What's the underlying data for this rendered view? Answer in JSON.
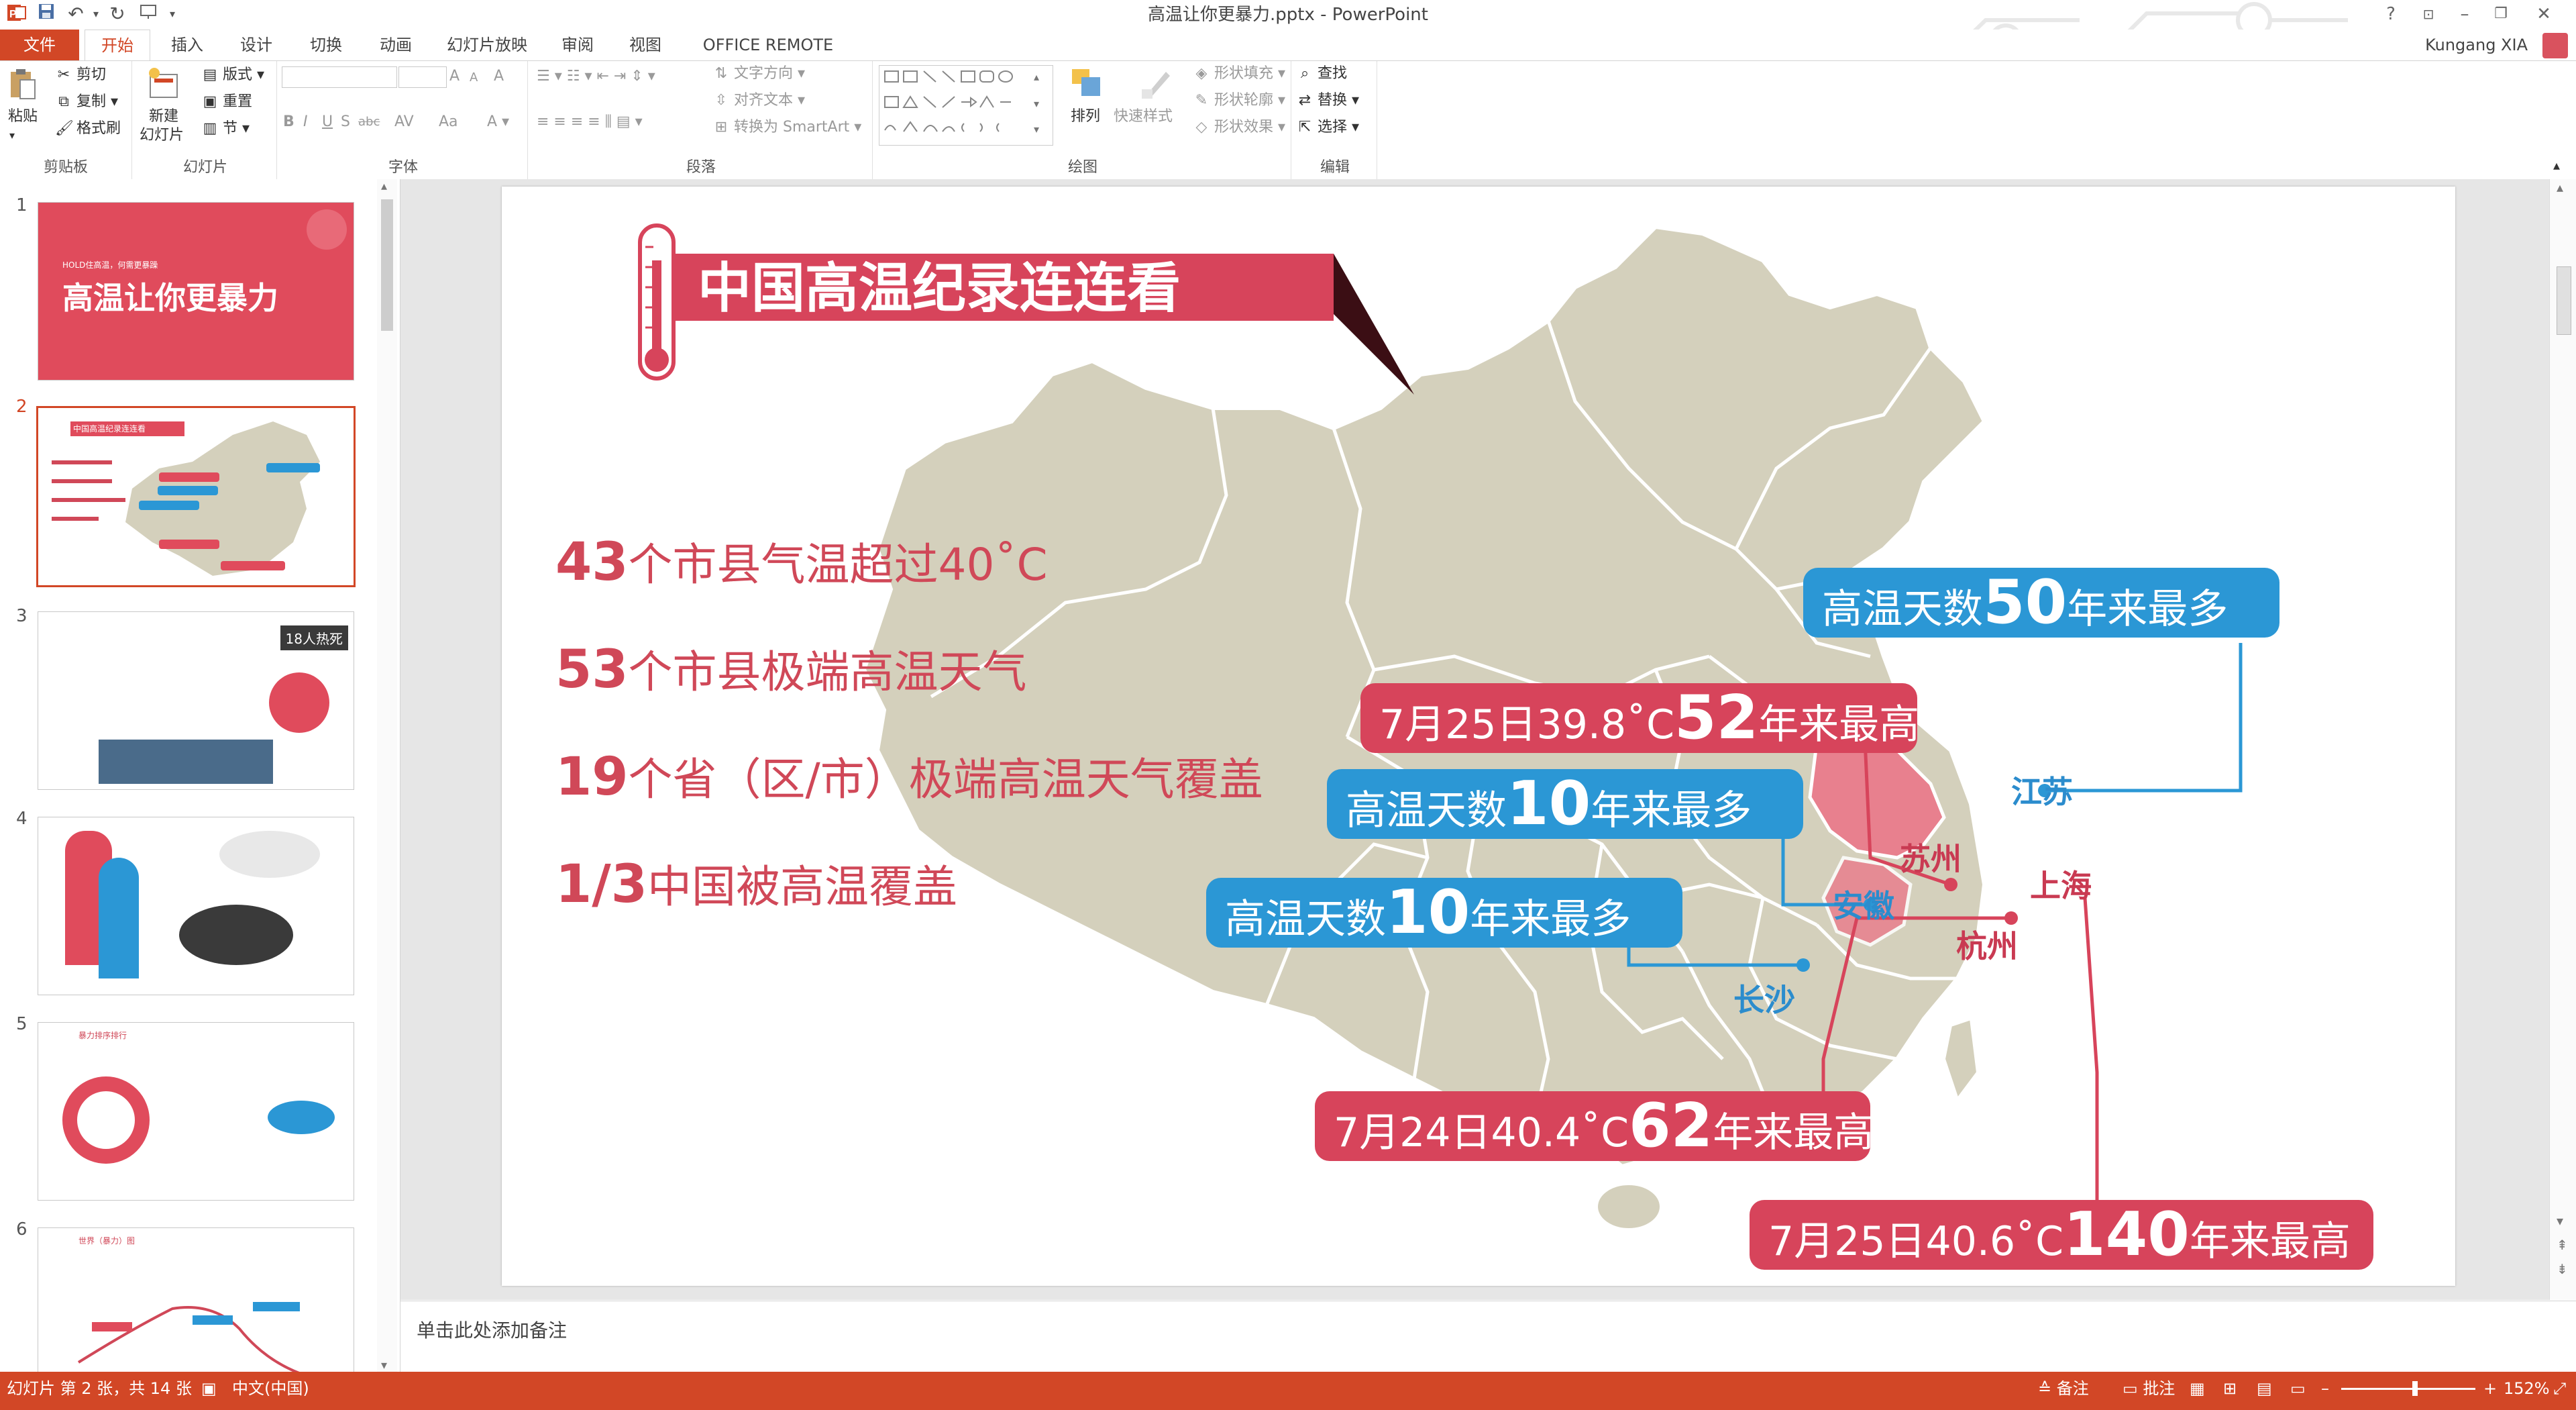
{
  "window": {
    "title": "高温让你更暴力.pptx - PowerPoint",
    "help": "?",
    "user": "Kungang XIA"
  },
  "tabs": [
    "文件",
    "开始",
    "插入",
    "设计",
    "切换",
    "动画",
    "幻灯片放映",
    "审阅",
    "视图",
    "OFFICE REMOTE"
  ],
  "ribbon": {
    "clipboard": {
      "label": "剪贴板",
      "paste": "粘贴",
      "cut": "剪切",
      "copy": "复制",
      "format_painter": "格式刷"
    },
    "slides": {
      "label": "幻灯片",
      "new_slide_1": "新建",
      "new_slide_2": "幻灯片",
      "layout": "版式",
      "reset": "重置",
      "section": "节"
    },
    "font": {
      "label": "字体",
      "bold": "B",
      "italic": "I",
      "underline": "U",
      "shadow": "S",
      "strike": "abc",
      "spacing": "AV",
      "case": "Aa",
      "increase": "A",
      "decrease": "A",
      "clear": "A"
    },
    "paragraph": {
      "label": "段落",
      "text_direction": "文字方向",
      "align_text": "对齐文本",
      "smartart": "转换为 SmartArt"
    },
    "drawing": {
      "label": "绘图",
      "arrange": "排列",
      "quick_styles": "快速样式",
      "shape_fill": "形状填充",
      "shape_outline": "形状轮廓",
      "shape_effects": "形状效果"
    },
    "editing": {
      "label": "编辑",
      "find": "查找",
      "replace": "替换",
      "select": "选择"
    }
  },
  "thumbnails": [
    {
      "num": "1",
      "title": "高温让你更暴力",
      "subtitle": "HOLD住高温，何需更暴躁"
    },
    {
      "num": "2",
      "title": "中国高温纪录连连看"
    },
    {
      "num": "3",
      "badge": "18人热死"
    },
    {
      "num": "4"
    },
    {
      "num": "5",
      "title": "暴力排序排行"
    },
    {
      "num": "6",
      "title": "世界（暴力）图"
    }
  ],
  "slide": {
    "title": "中国高温纪录连连看",
    "stats": [
      {
        "num": "43",
        "text": "个市县气温超过40˚C"
      },
      {
        "num": "53",
        "text": "个市县极端高温天气"
      },
      {
        "num": "19",
        "text": "个省（区/市）极端高温天气覆盖"
      },
      {
        "num": "1/3",
        "text": "中国被高温覆盖"
      }
    ],
    "callouts": {
      "jiangsu": {
        "pre": "高温天数",
        "num": "50",
        "post": "年来最多"
      },
      "c52": {
        "pre": "7月25日39.8˚C",
        "num": "52",
        "post": "年来最高"
      },
      "anhui": {
        "pre": "高温天数",
        "num": "10",
        "post": "年来最多"
      },
      "changsha": {
        "pre": "高温天数",
        "num": "10",
        "post": "年来最多"
      },
      "c62": {
        "pre": "7月24日40.4˚C",
        "num": "62",
        "post": "年来最高"
      },
      "c140": {
        "pre": "7月25日40.6˚C",
        "num": "140",
        "post": "年来最高"
      }
    },
    "cities": {
      "jiangsu": "江苏",
      "suzhou": "苏州",
      "anhui": "安徽",
      "shanghai": "上海",
      "hangzhou": "杭州",
      "changsha": "长沙"
    }
  },
  "notes": {
    "placeholder": "单击此处添加备注"
  },
  "status": {
    "slide_info": "幻灯片 第 2 张，共 14 张",
    "language": "中文(中国)",
    "notes_btn": "备注",
    "comments_btn": "批注",
    "zoom": "152%"
  },
  "colors": {
    "accent": "#d24726",
    "red": "#d7445b",
    "blue": "#2b97d5",
    "map": "#d4d0bc",
    "dark_red": "#3b0e14"
  }
}
